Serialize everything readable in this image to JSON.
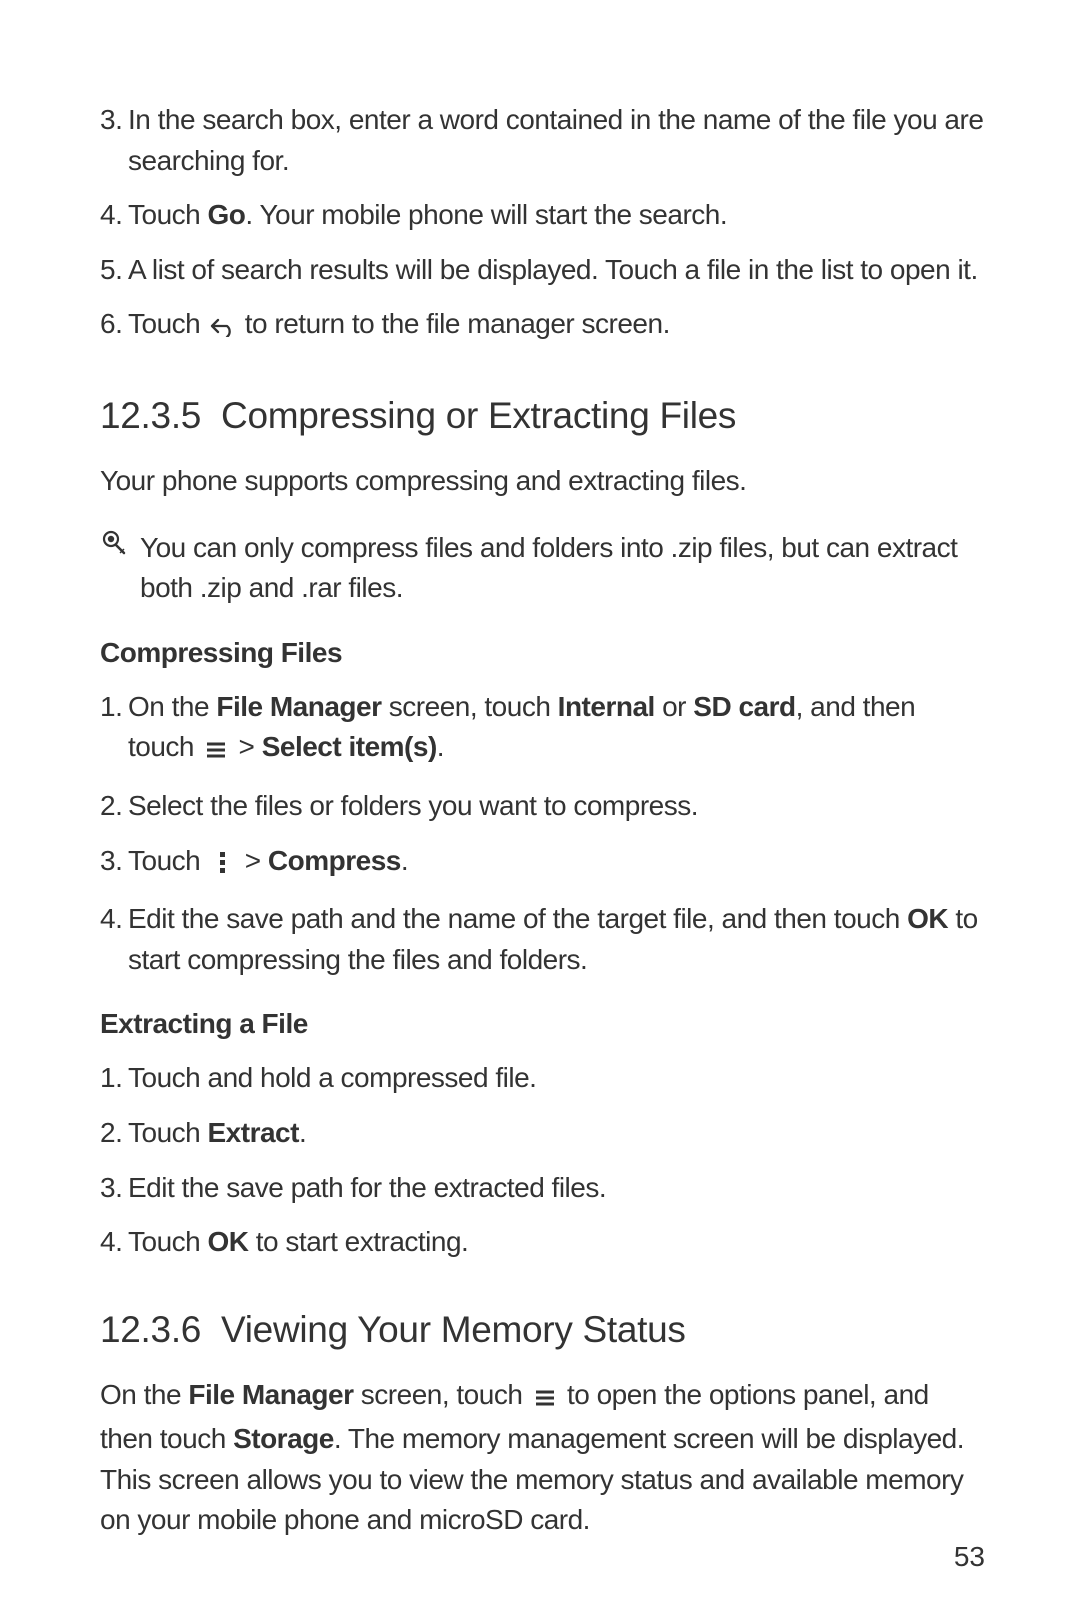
{
  "list_top": {
    "i3": {
      "num": "3.",
      "text": "In the search box, enter a word contained in the name of the file you are searching for."
    },
    "i4": {
      "num": "4.",
      "pre": "Touch ",
      "bold": "Go",
      "post": ". Your mobile phone will start the search."
    },
    "i5": {
      "num": "5.",
      "text": "A list of search results will be displayed. Touch a file in the list to open it."
    },
    "i6": {
      "num": "6.",
      "pre": "Touch ",
      "post": " to return to the file manager screen."
    }
  },
  "heading_1235": {
    "num": "12.3.5",
    "title": "Compressing or Extracting Files"
  },
  "para_1235": "Your phone supports compressing and extracting files.",
  "note_1235": "You can only compress files and folders into .zip files, but can extract both .zip and .rar files.",
  "sub_compressing": "Compressing Files",
  "compressing": {
    "i1": {
      "num": "1.",
      "pre": "On the ",
      "b1": "File Manager",
      "mid1": " screen, touch ",
      "b2": "Internal",
      "mid2": " or ",
      "b3": "SD card",
      "mid3": ", and then touch ",
      "gt": " > ",
      "b4": "Select item(s)",
      "end": "."
    },
    "i2": {
      "num": "2.",
      "text": "Select the files or folders you want to compress."
    },
    "i3": {
      "num": "3.",
      "pre": "Touch ",
      "gt": " > ",
      "b1": "Compress",
      "end": "."
    },
    "i4": {
      "num": "4.",
      "pre": "Edit the save path and the name of the target file, and then touch ",
      "b1": "OK",
      "post": " to start compressing the files and folders."
    }
  },
  "sub_extracting": "Extracting a File",
  "extracting": {
    "i1": {
      "num": "1.",
      "text": "Touch and hold a compressed file."
    },
    "i2": {
      "num": "2.",
      "pre": "Touch ",
      "b1": "Extract",
      "end": "."
    },
    "i3": {
      "num": "3.",
      "text": "Edit the save path for the extracted files."
    },
    "i4": {
      "num": "4.",
      "pre": "Touch ",
      "b1": "OK",
      "post": " to start extracting."
    }
  },
  "heading_1236": {
    "num": "12.3.6",
    "title": "Viewing Your Memory Status"
  },
  "para_1236": {
    "pre": "On the ",
    "b1": "File Manager",
    "mid1": " screen, touch ",
    "mid2": " to open the options panel, and then touch ",
    "b2": "Storage",
    "post": ". The memory management screen will be displayed. This screen allows you to view the memory status and available memory on your mobile phone and microSD card."
  },
  "page_num": "53"
}
